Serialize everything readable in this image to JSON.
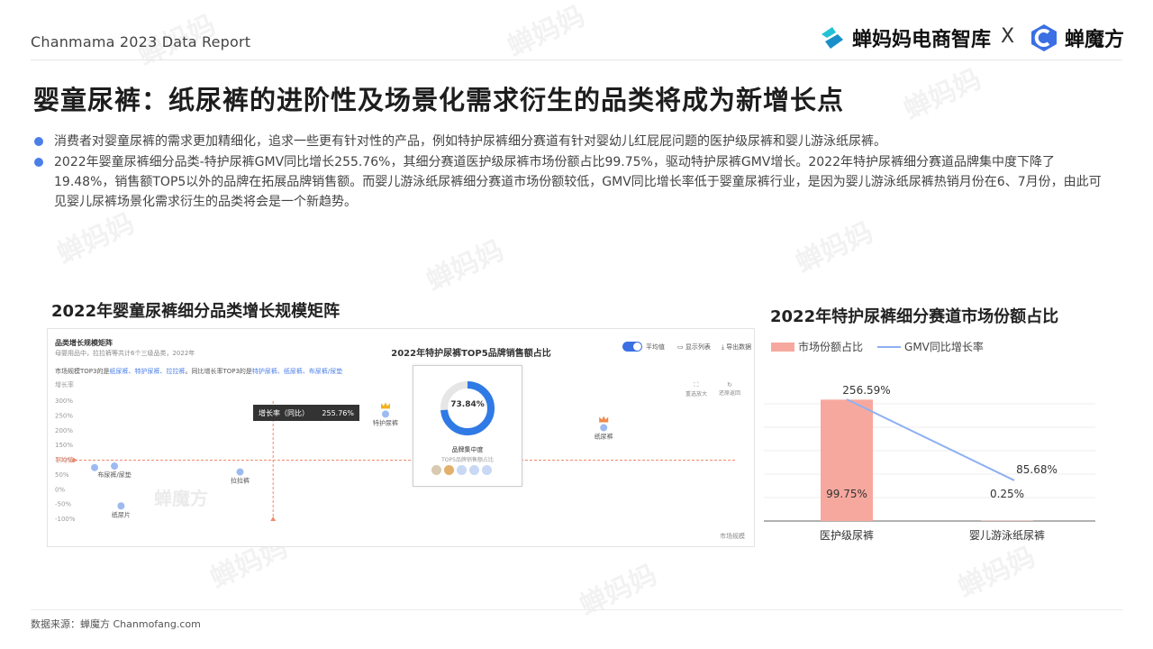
{
  "header": {
    "report_title": "Chanmama 2023 Data Report",
    "brand_left": "蝉妈妈电商智库",
    "separator": "X",
    "brand_right": "蝉魔方"
  },
  "page_title": "婴童尿裤：纸尿裤的进阶性及场景化需求衍生的品类将成为新增长点",
  "bullets": [
    "消费者对婴童尿裤的需求更加精细化，追求一些更有针对性的产品，例如特护尿裤细分赛道有针对婴幼儿红屁屁问题的医护级尿裤和婴儿游泳纸尿裤。",
    "2022年婴童尿裤细分品类-特护尿裤GMV同比增长255.76%，其细分赛道医护级尿裤市场份额占比99.75%，驱动特护尿裤GMV增长。2022年特护尿裤细分赛道品牌集中度下降了19.48%，销售额TOP5以外的品牌在拓展品牌销售额。而婴儿游泳纸尿裤细分赛道市场份额较低，GMV同比增长率低于婴童尿裤行业，是因为婴儿游泳纸尿裤热销月份在6、7月份，由此可见婴儿尿裤场景化需求衍生的品类将会是一个新趋势。"
  ],
  "left_section_title": "2022年婴童尿裤细分品类增长规模矩阵",
  "right_section_title": "2022年特护尿裤细分赛道市场份额占比",
  "matrix": {
    "panel_title": "品类增长规模矩阵",
    "panel_subtitle": "母婴用品中，拉拉裤等共计6个三级品类，2022年",
    "desc_prefix": "市场规模TOP3的是",
    "desc_top_size": "纸尿裤、特护尿裤、拉拉裤",
    "desc_mid": "。同比增长率TOP3的是",
    "desc_top_growth": "特护尿裤、纸尿裤、布尿裤/尿垫",
    "toggle_label": "平均值",
    "show_list": "显示列表",
    "export": "导出数据",
    "zoom_reset": "重选放大",
    "restore": "还原返回",
    "y_axis_title": "增长率",
    "y_ticks": [
      "300%",
      "250%",
      "200%",
      "150%",
      "100%",
      "50%",
      "0%",
      "-50%",
      "-100%"
    ],
    "avg_label": "平均值",
    "x_axis_label": "市场规模",
    "tooltip_label": "增长率（同比）",
    "tooltip_value": "255.76%",
    "points": [
      {
        "name": "特护尿裤",
        "growth": 256,
        "size": 0.47,
        "crown": "gold"
      },
      {
        "name": "纸尿裤",
        "growth": 210,
        "size": 0.8,
        "crown": "orange"
      },
      {
        "name": "拉拉裤",
        "growth": 60,
        "size": 0.25
      },
      {
        "name": "布尿裤/尿垫",
        "growth": 80,
        "size": 0.06
      },
      {
        "name": "",
        "growth": 75,
        "size": 0.03
      },
      {
        "name": "纸尿片",
        "growth": -55,
        "size": 0.07
      }
    ],
    "popup": {
      "title": "2022年特护尿裤TOP5品牌销售额占比",
      "percent": 73.84,
      "percent_label": "73.84%",
      "caption": "品牌集中度",
      "sub_caption": "TOP5品牌销售额占比"
    },
    "watermark": "蝉魔方"
  },
  "chart_data": {
    "type": "bar",
    "categories": [
      "医护级尿裤",
      "婴儿游泳纸尿裤"
    ],
    "series": [
      {
        "name": "市场份额占比",
        "type": "bar",
        "values": [
          99.75,
          0.25
        ],
        "labels": [
          "99.75%",
          "0.25%"
        ],
        "color": "#f7a89e"
      },
      {
        "name": "GMV同比增长率",
        "type": "line",
        "values": [
          256.59,
          85.68
        ],
        "labels": [
          "256.59%",
          "85.68%"
        ],
        "color": "#8fb0f2"
      }
    ],
    "title": "2022年特护尿裤细分赛道市场份额占比",
    "legend": "top-left",
    "grid": true
  },
  "source": "数据来源：蝉魔方 Chanmofang.com",
  "watermark_text": "蝉妈妈",
  "colors": {
    "accent": "#4a7ee8",
    "bar": "#f7a89e",
    "line": "#8fb0f2",
    "brand_cyan": "#1fb8c9"
  }
}
